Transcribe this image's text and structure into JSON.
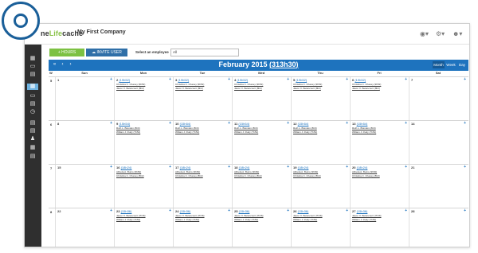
{
  "header": {
    "logo_pre": "ne",
    "logo_life": "Life",
    "logo_post": "cache",
    "company": "My First Company",
    "icons": [
      "globe-icon",
      "settings-icon",
      "user-icon"
    ]
  },
  "sidebar": {
    "items": [
      "calendar-icon",
      "folder-icon",
      "clipboard-icon",
      "calendar-active-icon",
      "folder-icon",
      "clipboard-icon",
      "clock-icon",
      "file-icon",
      "document-icon",
      "users-icon",
      "report-icon",
      "file-icon"
    ]
  },
  "toolbar": {
    "hours_label": "+ HOURS",
    "invite_label": "INVITE USER",
    "employee_label": "Select an employee",
    "employee_value": "All"
  },
  "calendar": {
    "month": "February 2015",
    "total_hours": "313h30",
    "views": {
      "month": "Month",
      "week": "Week",
      "day": "Day"
    },
    "week_col": "W",
    "days": [
      "Sun",
      "Mon",
      "Tue",
      "Wed",
      "Thu",
      "Fri",
      "Sat"
    ],
    "weeks": [
      {
        "num": "5",
        "days": [
          {
            "d": "1",
            "h": "",
            "e": []
          },
          {
            "d": "2",
            "h": "(19h52)",
            "e": [
              "Christina C. Chaney (9h52)",
              "Jason X. Betancourt (8h2)"
            ]
          },
          {
            "d": "3",
            "h": "(19h52)",
            "e": [
              "Christina C. Chaney (9h52)",
              "Jason X. Betancourt (8h2)"
            ]
          },
          {
            "d": "4",
            "h": "(19h52)",
            "e": [
              "Christina C. Chaney (9h52)",
              "Jason X. Betancourt (8h2)"
            ]
          },
          {
            "d": "5",
            "h": "(19h52)",
            "e": [
              "Christina C. Chaney (9h52)",
              "Jason X. Betancourt (8h2)"
            ]
          },
          {
            "d": "6",
            "h": "(19h52)",
            "e": [
              "Christina C. Chaney (9h52)",
              "Jason X. Betancourt (8h2)"
            ]
          },
          {
            "d": "7",
            "h": "",
            "e": []
          }
        ]
      },
      {
        "num": "6",
        "days": [
          {
            "d": "8",
            "h": "",
            "e": []
          },
          {
            "d": "9",
            "h": "(15h54)",
            "e": [
              "Ruth L. Brandon (8h0)",
              "William J. Rudy (7h54)"
            ]
          },
          {
            "d": "10",
            "h": "(15h54)",
            "e": [
              "Ruth L. Brandon (8h0)",
              "William J. Rudy (7h54)"
            ]
          },
          {
            "d": "11",
            "h": "(15h54)",
            "e": [
              "Ruth L. Brandon (8h0)",
              "William J. Rudy (7h54)"
            ]
          },
          {
            "d": "12",
            "h": "(15h54)",
            "e": [
              "Ruth L. Brandon (8h0)",
              "William J. Rudy (7h54)"
            ]
          },
          {
            "d": "13",
            "h": "(15h54)",
            "e": [
              "Ruth L. Brandon (8h0)",
              "William J. Rudy (7h54)"
            ]
          },
          {
            "d": "14",
            "h": "",
            "e": []
          }
        ]
      },
      {
        "num": "7",
        "days": [
          {
            "d": "15",
            "h": "",
            "e": []
          },
          {
            "d": "16",
            "h": "(18h24)",
            "e": [
              "Alfreda A. Burns (9h52)",
              "Christina C. Chaney (8h2)"
            ]
          },
          {
            "d": "17",
            "h": "(18h24)",
            "e": [
              "Alfreda A. Burns (9h52)",
              "Christina C. Chaney (8h2)"
            ]
          },
          {
            "d": "18",
            "h": "(18h24)",
            "e": [
              "Alfreda A. Burns (9h52)",
              "Christina C. Chaney (8h2)"
            ]
          },
          {
            "d": "19",
            "h": "(18h24)",
            "e": [
              "Alfreda A. Burns (9h52)",
              "Christina C. Chaney (8h2)"
            ]
          },
          {
            "d": "20",
            "h": "(18h24)",
            "e": [
              "Alfreda A. Burns (9h52)",
              "Christina C. Chaney (8h2)"
            ]
          },
          {
            "d": "21",
            "h": "",
            "e": []
          }
        ]
      },
      {
        "num": "8",
        "days": [
          {
            "d": "22",
            "h": "",
            "e": []
          },
          {
            "d": "23",
            "h": "(15h36)",
            "e": [
              "Jason X. Betancourt (7h36)",
              "William J. Rudy (7h54)"
            ]
          },
          {
            "d": "24",
            "h": "(15h36)",
            "e": [
              "Jason X. Betancourt (7h36)",
              "William J. Rudy (7h54)"
            ]
          },
          {
            "d": "25",
            "h": "(15h36)",
            "e": [
              "Jason X. Betancourt (7h36)",
              "William J. Rudy (7h54)"
            ]
          },
          {
            "d": "26",
            "h": "(15h36)",
            "e": [
              "Jason X. Betancourt (7h36)",
              "William J. Rudy (7h54)"
            ]
          },
          {
            "d": "27",
            "h": "(15h36)",
            "e": [
              "Jason X. Betancourt (7h36)",
              "William J. Rudy (7h54)"
            ]
          },
          {
            "d": "28",
            "h": "",
            "e": []
          }
        ]
      }
    ]
  }
}
